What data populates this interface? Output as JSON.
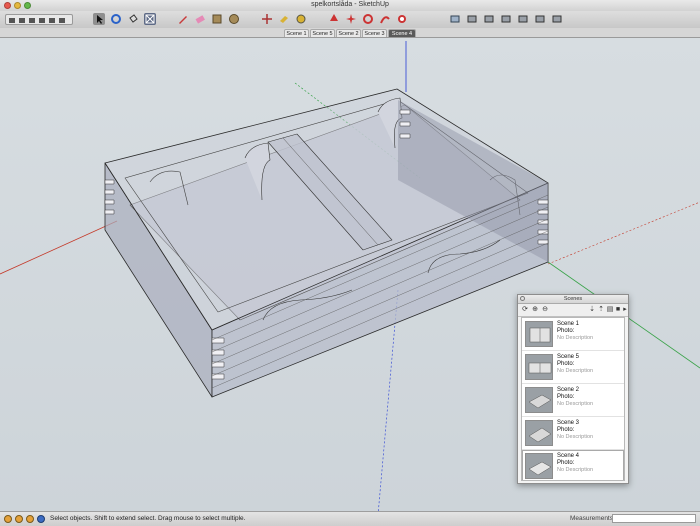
{
  "window": {
    "title": "spelkortslåda - SketchUp"
  },
  "toolbar": {
    "tools": [
      "views-toolbar-icon",
      "select-icon",
      "orbit-icon",
      "paint-bucket-icon",
      "zoom-extents-icon",
      "pencil-icon",
      "eraser-icon",
      "rectangle-icon",
      "circle-icon",
      "move-icon",
      "push-pull-icon",
      "tape-measure-icon",
      "shadow-icon",
      "star-icon",
      "rotate-icon",
      "follow-me-icon",
      "offset-icon",
      "camera-icon",
      "view-iso-icon",
      "view-top-icon",
      "view-front-icon",
      "view-right-icon",
      "view-back-icon",
      "view-left-icon"
    ]
  },
  "scene_tabs": [
    "Scene 1",
    "Scene 5",
    "Scene 2",
    "Scene 3",
    "Scene 4"
  ],
  "active_scene_tab": "Scene 4",
  "scenes_panel": {
    "title": "Scenes",
    "items": [
      {
        "name": "Scene 1",
        "photo": "Photo:",
        "description": "No Description"
      },
      {
        "name": "Scene 5",
        "photo": "Photo:",
        "description": "No Description"
      },
      {
        "name": "Scene 2",
        "photo": "Photo:",
        "description": "No Description"
      },
      {
        "name": "Scene 3",
        "photo": "Photo:",
        "description": "No Description"
      },
      {
        "name": "Scene 4",
        "photo": "Photo:",
        "description": "No Description"
      }
    ]
  },
  "statusbar": {
    "hint": "Select objects. Shift to extend select. Drag mouse to select multiple.",
    "measurements_label": "Measurements",
    "measurements_value": ""
  },
  "colors": {
    "axis_red": "#c43a2a",
    "axis_green": "#3aa34a",
    "axis_blue": "#3a4fd6",
    "model_edge": "#2b2b2b",
    "model_fill": "#b9bfd0"
  }
}
